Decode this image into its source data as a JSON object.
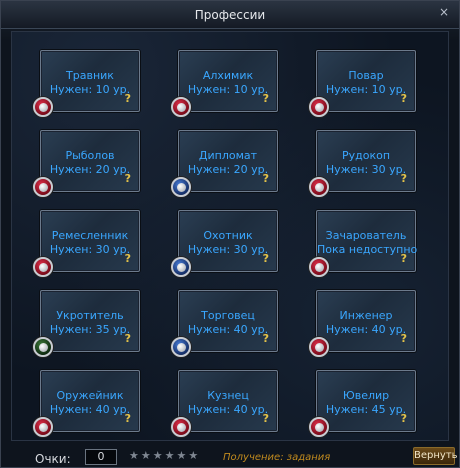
{
  "window": {
    "title": "Профессии",
    "close_label": "×"
  },
  "professions": [
    {
      "name": "Травник",
      "requirement": "Нужен: 10 ур.",
      "help": "?",
      "badge": "red"
    },
    {
      "name": "Алхимик",
      "requirement": "Нужен: 10 ур.",
      "help": "?",
      "badge": "red"
    },
    {
      "name": "Повар",
      "requirement": "Нужен: 10 ур.",
      "help": "?",
      "badge": "red"
    },
    {
      "name": "Рыболов",
      "requirement": "Нужен: 20 ур.",
      "help": "?",
      "badge": "red"
    },
    {
      "name": "Дипломат",
      "requirement": "Нужен: 20 ур.",
      "help": "?",
      "badge": "blue"
    },
    {
      "name": "Рудокоп",
      "requirement": "Нужен: 30 ур.",
      "help": "?",
      "badge": "red"
    },
    {
      "name": "Ремесленник",
      "requirement": "Нужен: 30 ур.",
      "help": "?",
      "badge": "red"
    },
    {
      "name": "Охотник",
      "requirement": "Нужен: 30 ур.",
      "help": "?",
      "badge": "blue"
    },
    {
      "name": "Зачарователь",
      "requirement": "Пока недоступно",
      "help": "?",
      "badge": "red"
    },
    {
      "name": "Укротитель",
      "requirement": "Нужен: 35 ур.",
      "help": "?",
      "badge": "green"
    },
    {
      "name": "Торговец",
      "requirement": "Нужен: 40 ур.",
      "help": "?",
      "badge": "blue"
    },
    {
      "name": "Инженер",
      "requirement": "Нужен: 40 ур.",
      "help": "?",
      "badge": "red"
    },
    {
      "name": "Оружейник",
      "requirement": "Нужен: 40 ур.",
      "help": "?",
      "badge": "red"
    },
    {
      "name": "Кузнец",
      "requirement": "Нужен: 40 ур.",
      "help": "?",
      "badge": "red"
    },
    {
      "name": "Ювелир",
      "requirement": "Нужен: 45 ур.",
      "help": "?",
      "badge": "red"
    }
  ],
  "footer": {
    "points_label": "Очки:",
    "points_value": "0",
    "stars": [
      "★",
      "★",
      "★",
      "★",
      "★",
      "★"
    ],
    "obtain_text": "Получение: задания",
    "return_label": "Вернуть"
  },
  "colors": {
    "text_blue": "#3aa7ff",
    "help_yellow": "#e4c34a",
    "obtain_orange": "#c08a1e"
  }
}
